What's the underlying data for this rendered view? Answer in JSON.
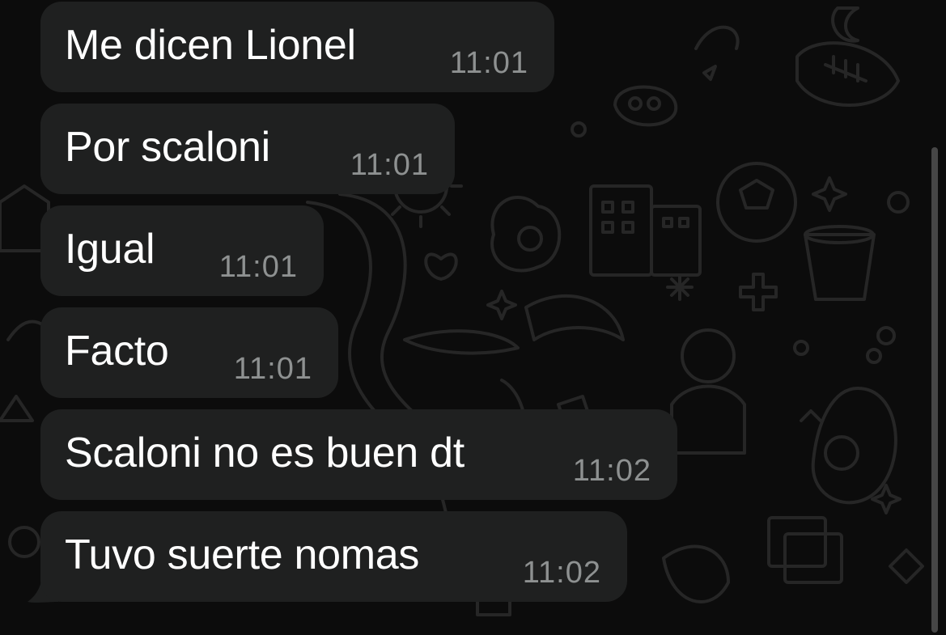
{
  "conversation": {
    "messages": [
      {
        "text": "Me dicen Lionel",
        "time": "11:01"
      },
      {
        "text": "Por scaloni",
        "time": "11:01"
      },
      {
        "text": "Igual",
        "time": "11:01"
      },
      {
        "text": "Facto",
        "time": "11:01"
      },
      {
        "text": "Scaloni no es buen dt",
        "time": "11:02"
      },
      {
        "text": "Tuvo suerte nomas",
        "time": "11:02"
      }
    ]
  },
  "colors": {
    "background": "#0c0c0c",
    "bubble": "#1f2020",
    "message_text": "#ffffff",
    "timestamp": "#8e9191",
    "wallpaper_doodles": "#262626"
  },
  "icons": {
    "wallpaper": "doodle-pattern",
    "bubble_tail": "bubble-tail"
  }
}
